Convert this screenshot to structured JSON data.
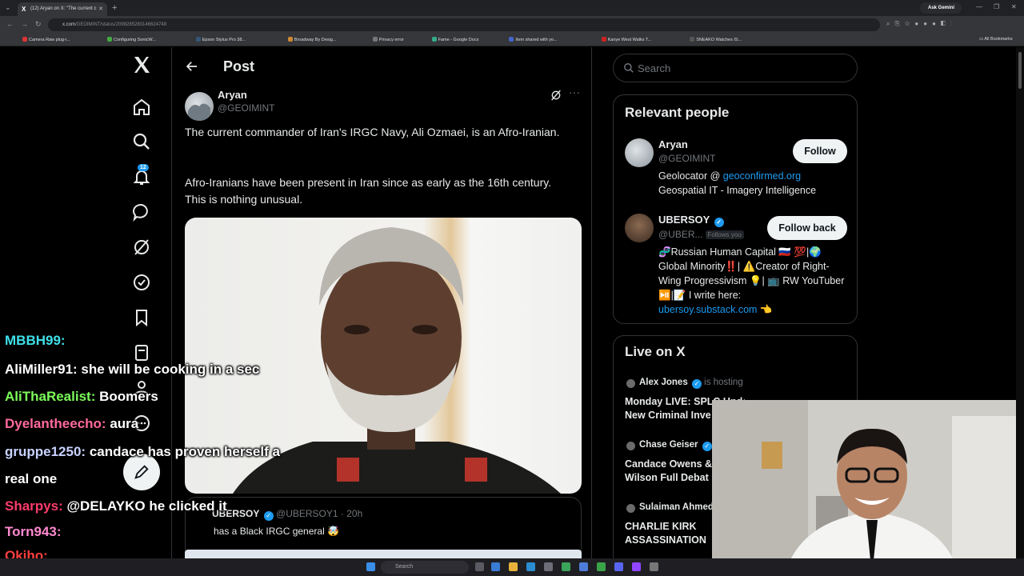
{
  "browser": {
    "tab_title": "(12) Aryan on X: \"The current c",
    "url_host": "x.com",
    "url_path": "/GEOIMINT/status/2098285280146624748",
    "ask_gemini": "Ask Gemini",
    "bookmarks": [
      "Camera Raw plug-i...",
      "Configuring SonicW...",
      "Epson Stylus Pro 38...",
      "Broadway By Desig...",
      "Privacy error",
      "Fame - Google Docs",
      "Item shared with yo...",
      "Kanye West Walks T...",
      "SNEAKO Watches IS..."
    ],
    "all_bookmarks": "All Bookmarks"
  },
  "nav": {
    "notification_count": "12"
  },
  "post": {
    "header_title": "Post",
    "author_name": "Aryan",
    "author_handle": "@GEOIMINT",
    "paragraph_1": "The current commander of Iran's IRGC Navy, Ali Ozmaei, is an Afro-Iranian.",
    "paragraph_2": "Afro-Iranians have been present in Iran since as early as the 16th century. This is nothing unusual."
  },
  "reply": {
    "author": "UBERSOY",
    "handle_time": "@UBERSOY1 · 20h",
    "text": "has a Black IRGC general 🤯"
  },
  "sidebar": {
    "search_placeholder": "Search",
    "relevant_title": "Relevant people",
    "people": [
      {
        "name": "Aryan",
        "handle": "@GEOIMINT",
        "button": "Follow",
        "bio_prefix": "Geolocator @ ",
        "bio_link": "geoconfirmed.org",
        "bio_rest": "Geospatial IT - Imagery Intelligence"
      },
      {
        "name": "UBERSOY",
        "handle": "@UBER...",
        "follows_you": "Follows you",
        "button": "Follow back",
        "bio_line1": "🧬Russian Human Capital 🇷🇺 💯|🌍",
        "bio_line2": "Global Minority‼️| ⚠️Creator of Right-",
        "bio_line3": "Wing Progressivism 💡| 📺 RW YouTuber",
        "bio_line4": "⏯️|📝 I write here:",
        "bio_link": "ubersoy.substack.com",
        "bio_emoji": "👈"
      }
    ],
    "live_title": "Live on X",
    "live_items": [
      {
        "host": "Alex Jones",
        "suffix": "is hosting",
        "title_1": "Monday LIVE: SPLC Under",
        "title_2": "New Criminal Inve"
      },
      {
        "host": "Chase Geiser",
        "suffix": "",
        "title_1": "Candace Owens &",
        "title_2": "Wilson Full Debat"
      },
      {
        "host": "Sulaiman Ahmed",
        "suffix": "",
        "title_1": "CHARLIE KIRK",
        "title_2": "ASSASSINATION"
      }
    ]
  },
  "chat": [
    {
      "user": "MBBH99:",
      "color": "#3fe0e8",
      "msg": ""
    },
    {
      "user": "AliMiller91:",
      "color": "#ffffff",
      "msg": " she will be cooking in a sec"
    },
    {
      "user": "AliThaRealist:",
      "color": "#7cfc5a",
      "msg": " Boomers"
    },
    {
      "user": "Dyelantheecho:",
      "color": "#ff6a9a",
      "msg": " aura"
    },
    {
      "user": "gruppe1250:",
      "color": "#c9d2ff",
      "msg": " candace has proven herself a"
    },
    {
      "user": "",
      "color": "#ffffff",
      "msg": "real one"
    },
    {
      "user": "Sharpys:",
      "color": "#ff3b6b",
      "msg": " @DELAYKO he clicked it"
    },
    {
      "user": "Torn943:",
      "color": "#ff8ad0",
      "msg": ""
    },
    {
      "user": "Okiho:",
      "color": "#ff4040",
      "msg": ""
    }
  ],
  "taskbar": {
    "search": "Search"
  },
  "colors": {
    "accent": "#1d9bf0",
    "background": "#000000",
    "border": "#2f3336",
    "muted": "#71767b"
  }
}
